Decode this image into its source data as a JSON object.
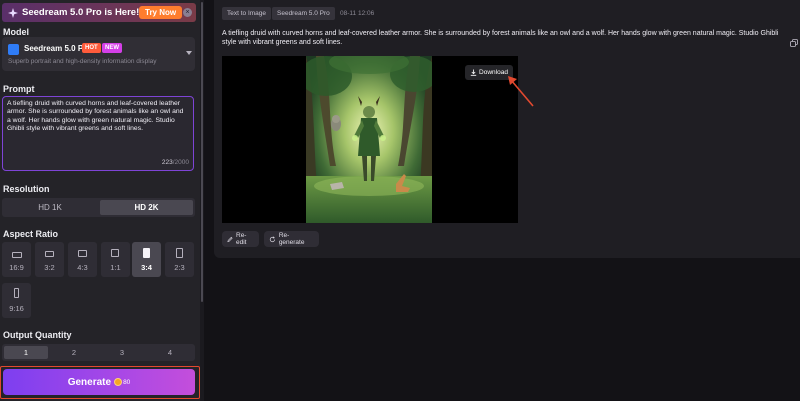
{
  "banner": {
    "title": "Seedream 5.0 Pro is Here!",
    "try_label": "Try Now",
    "close_label": "×"
  },
  "model": {
    "section_label": "Model",
    "name": "Seedream 5.0 Pro",
    "badge_hot": "HOT",
    "badge_new": "NEW",
    "description": "Superb portrait and high-density information display"
  },
  "prompt": {
    "section_label": "Prompt",
    "text": "A tiefling druid with curved horns and leaf-covered leather armor. She is surrounded by forest animals like an owl and a wolf. Her hands glow with green natural magic. Studio Ghibli style with vibrant greens and soft lines.",
    "count_current": "223",
    "count_max": "/2000"
  },
  "resolution": {
    "section_label": "Resolution",
    "options": [
      "HD 1K",
      "HD 2K"
    ],
    "selected": "HD 2K"
  },
  "aspect_ratio": {
    "section_label": "Aspect Ratio",
    "options": [
      "16:9",
      "3:2",
      "4:3",
      "1:1",
      "3:4",
      "2:3",
      "9:16"
    ],
    "selected": "3:4"
  },
  "quantity": {
    "section_label": "Output Quantity",
    "options": [
      "1",
      "2",
      "3",
      "4"
    ],
    "selected": "1"
  },
  "generate": {
    "label": "Generate",
    "cost": "80"
  },
  "result": {
    "tags": [
      "Text to Image",
      "Seedream 5.0 Pro"
    ],
    "date": "08-11 12:06",
    "description": "A tiefling druid with curved horns and leaf-covered leather armor. She is surrounded by forest animals like an owl and a wolf. Her hands glow with green natural magic. Studio Ghibli style with vibrant greens and soft lines.",
    "download_label": "Download",
    "reedit_label": "Re-edit",
    "regenerate_label": "Re-generate"
  },
  "colors": {
    "accent_purple": "#8b44ec",
    "try_orange": "#ff7d2e",
    "highlight_red": "#e2492f"
  },
  "icons": [
    "sparkle-icon",
    "close-icon",
    "model-logo-icon",
    "chevron-down-icon",
    "coin-icon",
    "copy-icon",
    "download-icon",
    "edit-icon",
    "refresh-icon"
  ]
}
